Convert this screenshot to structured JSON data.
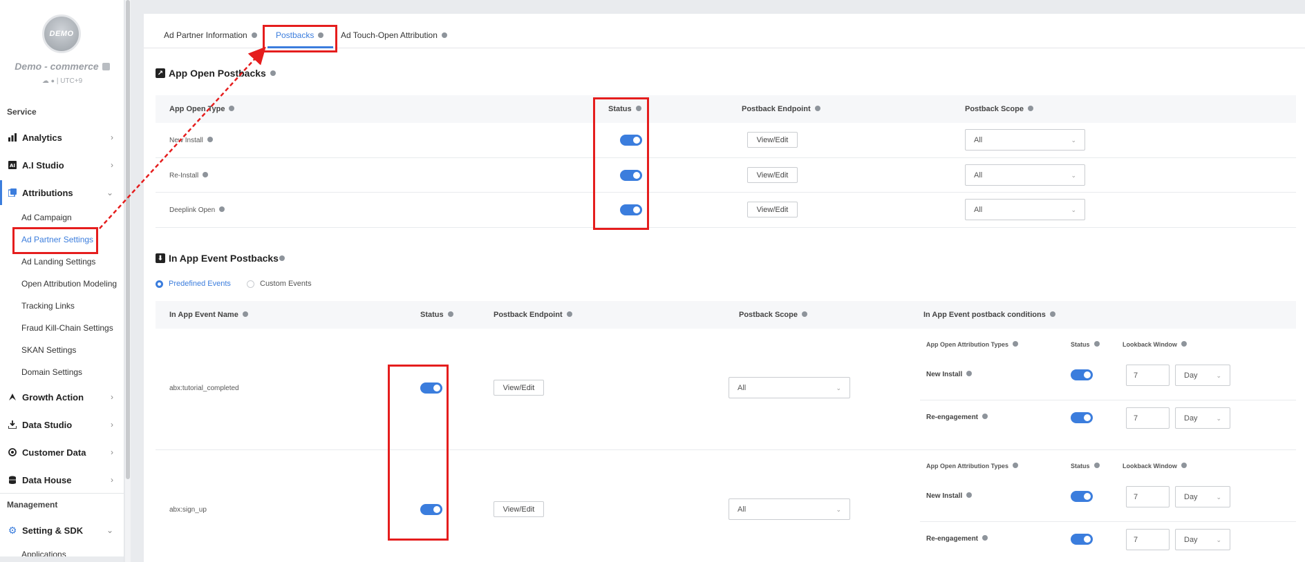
{
  "app": {
    "avatar_text": "DEMO",
    "name": "Demo - commerce",
    "meta": "☁  | UTC+9"
  },
  "sidebar": {
    "service_label": "Service",
    "management_label": "Management",
    "items": [
      {
        "label": "Analytics",
        "icon": "bar-chart-icon"
      },
      {
        "label": "A.I Studio",
        "icon": "ai-icon"
      },
      {
        "label": "Attributions",
        "icon": "attribution-icon"
      },
      {
        "label": "Growth Action",
        "icon": "growth-icon"
      },
      {
        "label": "Data Studio",
        "icon": "download-icon"
      },
      {
        "label": "Customer Data",
        "icon": "target-icon"
      },
      {
        "label": "Data House",
        "icon": "database-icon"
      },
      {
        "label": "Setting & SDK",
        "icon": "gear-icon"
      }
    ],
    "sub_items": [
      "Ad Campaign",
      "Ad Partner Settings",
      "Ad Landing Settings",
      "Open Attribution Modeling",
      "Tracking Links",
      "Fraud Kill-Chain Settings",
      "SKAN Settings",
      "Domain Settings"
    ],
    "setting_sub": "Applications"
  },
  "tabs": [
    "Ad Partner Information",
    "Postbacks",
    "Ad Touch-Open Attribution"
  ],
  "app_open": {
    "title": "App Open Postbacks",
    "headers": [
      "App Open Type",
      "Status",
      "Postback Endpoint",
      "Postback Scope"
    ],
    "rows": [
      {
        "type": "New Install",
        "button": "View/Edit",
        "scope": "All"
      },
      {
        "type": "Re-Install",
        "button": "View/Edit",
        "scope": "All"
      },
      {
        "type": "Deeplink Open",
        "button": "View/Edit",
        "scope": "All"
      }
    ]
  },
  "in_app": {
    "title": "In App Event Postbacks",
    "radio_predefined": "Predefined Events",
    "radio_custom": "Custom Events",
    "headers": [
      "In App Event Name",
      "Status",
      "Postback Endpoint",
      "Postback Scope",
      "In App Event postback conditions"
    ],
    "sub_headers": [
      "App Open Attribution Types",
      "Status",
      "Lookback Window"
    ],
    "rows": [
      {
        "name": "abx:tutorial_completed",
        "button": "View/Edit",
        "scope": "All",
        "conditions": [
          {
            "type": "New Install",
            "days": "7",
            "unit": "Day"
          },
          {
            "type": "Re-engagement",
            "days": "7",
            "unit": "Day"
          }
        ]
      },
      {
        "name": "abx:sign_up",
        "button": "View/Edit",
        "scope": "All",
        "conditions": [
          {
            "type": "New Install",
            "days": "7",
            "unit": "Day"
          },
          {
            "type": "Re-engagement",
            "days": "7",
            "unit": "Day"
          }
        ]
      }
    ]
  },
  "colors": {
    "accent": "#3b7ddd",
    "annotation": "#e51d1d"
  }
}
